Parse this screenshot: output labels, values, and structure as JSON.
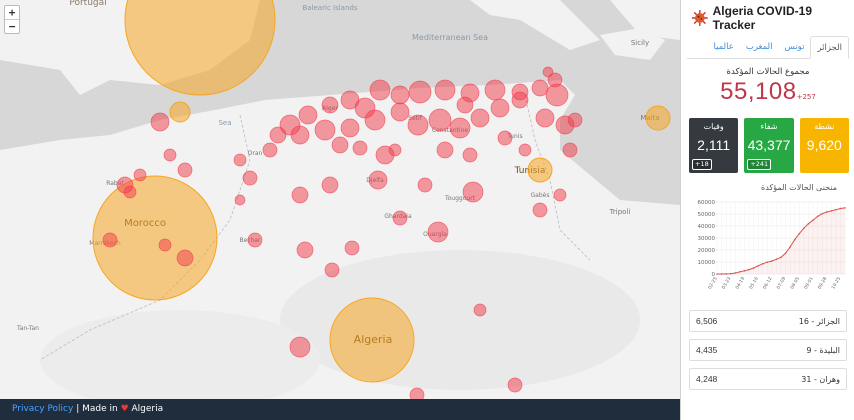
{
  "map": {
    "zoom_in": "+",
    "zoom_out": "−",
    "labels": {
      "portugal": "Portugal",
      "mediterranean": "Mediterranean Sea",
      "morocco": "Morocco",
      "algeria": "Algeria",
      "tunisia": "Tunisia",
      "tripoli": "Tripoli",
      "malta": "Malta",
      "sicily": "Sicily",
      "tunis": "Tunis",
      "constantine": "Constantine",
      "oran": "Oran",
      "alger": "Alger",
      "setif": "Setif",
      "djelfa": "Djelfa",
      "ouargla": "Ouargla",
      "ghardaia": "Ghardaia",
      "bechar": "Bechar",
      "touggourt": "Touggourt",
      "rabat": "Rabat",
      "marrakech": "Marrakech",
      "tan_tan": "Tan-Tan",
      "sea": "Sea",
      "gabes": "Gabès",
      "baleares": "Balearic Islands"
    },
    "colors": {
      "case_circle": "#f2394a",
      "country_circle": "#f6a623"
    }
  },
  "footer": {
    "privacy": "Privacy Policy",
    "separator": " | Made in ",
    "heart": "♥",
    "country": " Algeria"
  },
  "panel": {
    "title": "Algeria COVID-19 Tracker",
    "tabs": [
      "الجزائر",
      "تونس",
      "المغرب",
      "عالميا"
    ],
    "active_tab": 0,
    "total_label": "مجموع الحالات المؤكدة",
    "total_value": "55,108",
    "total_delta": "+257",
    "stats": {
      "deaths": {
        "label": "وفيات",
        "value": "2,111",
        "change": "+18"
      },
      "recovered": {
        "label": "شفاء",
        "value": "43,377",
        "change": "+241"
      },
      "active": {
        "label": "نشطة",
        "value": "9,620"
      }
    },
    "chart_title": "منحنى الحالات المؤكدة",
    "rows": [
      {
        "name": "16 - الجزائر",
        "count": "6,506"
      },
      {
        "name": "9 - البليدة",
        "count": "4,435"
      },
      {
        "name": "31 - وهران",
        "count": "4,248"
      }
    ],
    "colors": {
      "deaths": "#343a40",
      "recovered": "#28a745",
      "active": "#f7b500",
      "total": "#c0364a"
    }
  },
  "chart_data": {
    "type": "line",
    "title": "منحنى الحالات المؤكدة",
    "x": [
      "02-25",
      "03-05",
      "03-14",
      "03-23",
      "04-01",
      "04-10",
      "04-19",
      "04-28",
      "05-07",
      "05-16",
      "05-25",
      "06-03",
      "06-12",
      "06-21",
      "06-30",
      "07-09",
      "07-18",
      "07-27",
      "08-05",
      "08-14",
      "08-23",
      "09-01",
      "09-10",
      "09-19",
      "09-28",
      "10-07",
      "10-16",
      "10-25",
      "11-03"
    ],
    "series": [
      {
        "values": [
          1,
          17,
          48,
          230,
          847,
          1825,
          2629,
          3649,
          4997,
          6821,
          8503,
          9831,
          10810,
          12248,
          13907,
          17348,
          22549,
          28615,
          33626,
          38133,
          41858,
          44833,
          48007,
          50214,
          51690,
          52581,
          53584,
          54616,
          55108
        ]
      }
    ],
    "ylim": [
      0,
      60000
    ],
    "yticks": [
      0,
      10000,
      20000,
      30000,
      40000,
      50000,
      60000
    ],
    "ytick_labels": [
      "0",
      "10000",
      "20000",
      "30000",
      "40000",
      "50000",
      "60000"
    ],
    "grid": true,
    "color": "#d9534f"
  }
}
